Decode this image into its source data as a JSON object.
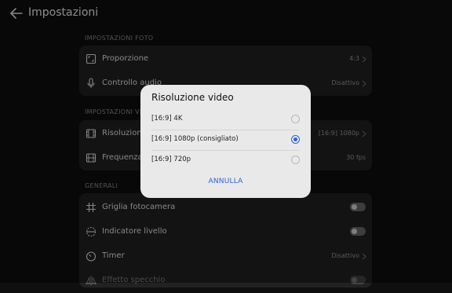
{
  "header": {
    "title": "Impostazioni"
  },
  "photo_section": {
    "title": "IMPOSTAZIONI FOTO",
    "rows": [
      {
        "icon": "aspect-ratio-icon",
        "label": "Proporzione",
        "value": "4:3"
      },
      {
        "icon": "microphone-icon",
        "label": "Controllo audio",
        "value": "Disattivo"
      }
    ]
  },
  "video_section": {
    "title": "IMPOSTAZIONI VIDEO",
    "rows": [
      {
        "icon": "film-icon",
        "label": "Risoluzione video",
        "value": "[16:9] 1080p"
      },
      {
        "icon": "film-frames-icon",
        "label": "Frequenza fotogrammi",
        "value": "30 fps"
      }
    ]
  },
  "general_section": {
    "title": "GENERALI",
    "rows": [
      {
        "icon": "grid-icon",
        "label": "Griglia fotocamera",
        "toggle": false
      },
      {
        "icon": "level-icon",
        "label": "Indicatore livello",
        "toggle": false
      },
      {
        "icon": "timer-icon",
        "label": "Timer",
        "value": "Disattivo"
      },
      {
        "icon": "mirror-icon",
        "label": "Effetto specchio",
        "toggle": false
      }
    ]
  },
  "dialog": {
    "title": "Risoluzione video",
    "options": [
      {
        "label": "[16:9] 4K",
        "selected": false
      },
      {
        "label": "[16:9] 1080p (consigliato)",
        "selected": true
      },
      {
        "label": "[16:9] 720p",
        "selected": false
      }
    ],
    "cancel_label": "ANNULLA"
  },
  "colors": {
    "accent": "#2f63e0",
    "card": "#222222",
    "background": "#0f0f0f"
  }
}
